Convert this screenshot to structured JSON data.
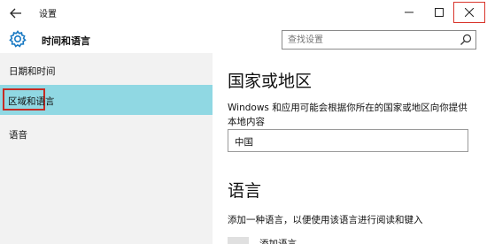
{
  "window": {
    "title": "设置"
  },
  "header": {
    "title": "时间和语言"
  },
  "search": {
    "placeholder": "查找设置",
    "value": ""
  },
  "sidebar": {
    "items": [
      {
        "label": "日期和时间",
        "selected": false
      },
      {
        "label": "区域和语言",
        "selected": true
      },
      {
        "label": "语音",
        "selected": false
      }
    ]
  },
  "main": {
    "region_heading": "国家或地区",
    "region_description": "Windows 和应用可能会根据你所在的国家或地区向你提供本地内容",
    "country_value": "中国",
    "language_heading": "语言",
    "language_description": "添加一种语言，以便使用该语言进行阅读和键入",
    "add_language_label": "添加语言"
  },
  "colors": {
    "selected_bg": "#90d8e3",
    "sidebar_bg": "#f2f2f2",
    "highlight_border": "#c62b24",
    "accent": "#1979c3"
  }
}
